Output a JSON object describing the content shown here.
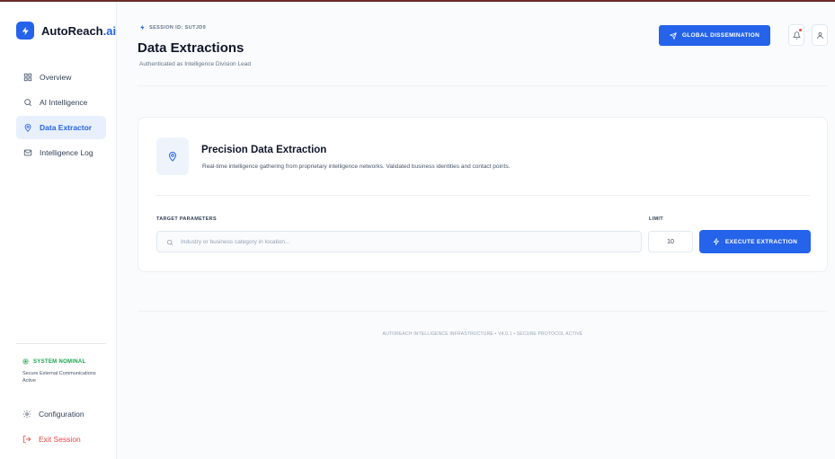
{
  "brand": {
    "name_main": "AutoReach",
    "name_suffix": ".ai"
  },
  "sidebar": {
    "items": [
      {
        "label": "Overview",
        "icon": "grid-icon",
        "active": false
      },
      {
        "label": "AI Intelligence",
        "icon": "search-icon",
        "active": false
      },
      {
        "label": "Data Extractor",
        "icon": "map-pin-icon",
        "active": true
      },
      {
        "label": "Intelligence Log",
        "icon": "mail-icon",
        "active": false
      }
    ],
    "system_status": {
      "title": "SYSTEM NOMINAL",
      "description": "Secure External Communications Active"
    },
    "bottom": [
      {
        "label": "Configuration",
        "icon": "gear-icon"
      },
      {
        "label": "Exit Session",
        "icon": "logout-icon"
      }
    ]
  },
  "header": {
    "session_id": "SESSION ID: SUTJD9",
    "title": "Data Extractions",
    "subtitle": "Authenticated as Intelligence Division Lead",
    "global_button": "GLOBAL DISSEMINATION"
  },
  "card": {
    "title": "Precision Data Extraction",
    "description": "Real-time intelligence gathering from proprietary intelligence networks. Validated business identities and contact points.",
    "target_label": "TARGET PARAMETERS",
    "search_placeholder": "Industry or business category in location...",
    "limit_label": "LIMIT",
    "limit_value": "10",
    "execute_button": "EXECUTE EXTRACTION"
  },
  "footer": {
    "text": "AUTOREACH INTELLIGENCE INFRASTRUCTURE • V4.0.1 • SECURE PROTOCOL ACTIVE"
  },
  "colors": {
    "accent": "#2563eb",
    "success": "#16a34a",
    "danger": "#ef4444",
    "active_bg": "#e8f0fd"
  }
}
